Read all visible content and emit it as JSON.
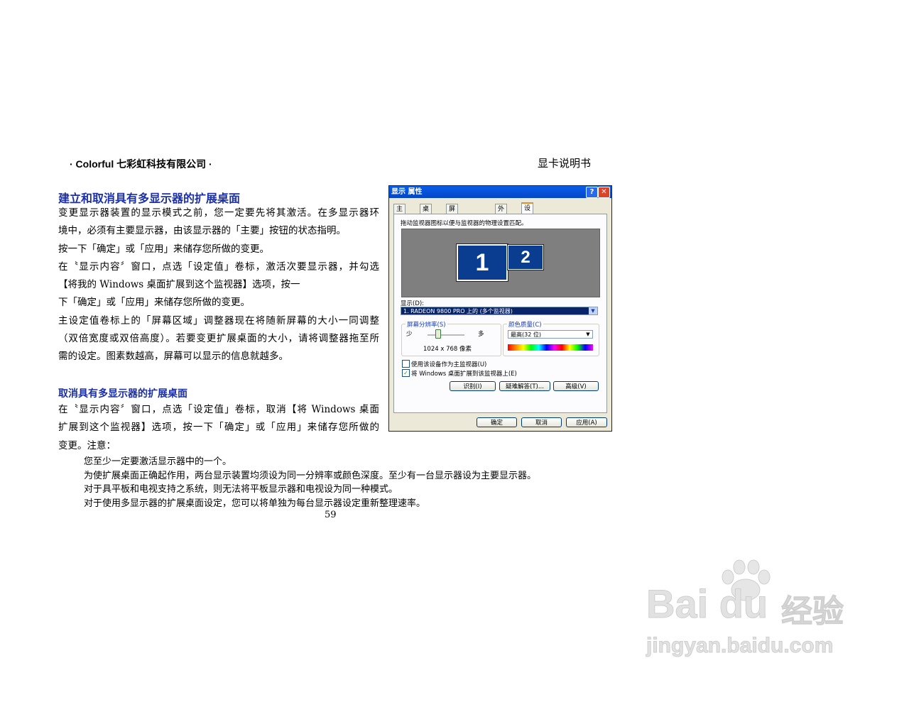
{
  "header": {
    "left": "· Colorful  七彩虹科技有限公司 ·",
    "right": "显卡说明书"
  },
  "section1": {
    "title": "建立和取消具有多显示器的扩展桌面",
    "lines": [
      "变更显示器装置的显示模式之前，您一定要先将其激活。在多显示器环",
      "境中，必须有主要显示器，由该显示器的「主要」按钮的状态指明。",
      "按一下「确定」或「应用」来储存您所做的变更。",
      "在〝显示内容〞窗口，点选「设定值」卷标，激活次要显示器，并勾选",
      "【将我的 Windows 桌面扩展到这个监视器】选项，按一",
      "下「确定」或「应用」来储存您所做的变更。",
      "主设定值卷标上的「屏幕区域」调整器现在将随新屏幕的大小一同调整",
      "（双倍宽度或双倍高度）。若要变更扩展桌面的大小，请将调整器拖至所",
      "需的设定。图素数越高，屏幕可以显示的信息就越多。"
    ]
  },
  "section2": {
    "title": "取消具有多显示器的扩展桌面",
    "lines": [
      "在〝显示内容〞窗口，点选「设定值」卷标，取消【将 Windows 桌面",
      "扩展到这个监视器】选项，按一下「确定」或「应用」来储存您所做的",
      "变更。注意："
    ]
  },
  "notes": [
    "您至少一定要激活显示器中的一个。",
    "为使扩展桌面正确起作用，两台显示装置均须设为同一分辨率或颜色深度。至少有一台显示器设为主要显示器。",
    "对于具平板和电视支持之系统，则无法将平板显示器和电视设为同一种模式。",
    "对于使用多显示器的扩展桌面设定，您可以将单独为每台显示器设定重新整理速率。"
  ],
  "page_number": "59",
  "dialog": {
    "title": "显示 属性",
    "help_glyph": "?",
    "close_glyph": "✕",
    "tabs": [
      "主题",
      "桌面",
      "屏幕保护程序",
      "外观",
      "设置"
    ],
    "active_tab": "设置",
    "instruction": "拖动监视器图标以便与监视器的物理设置匹配。",
    "monitor1": "1",
    "monitor2": "2",
    "display_label": "显示(D):",
    "display_value": "1. RADEON 9800 PRO 上的 (多个监视器)",
    "resolution": {
      "title": "屏幕分辨率(S)",
      "less": "少",
      "more": "多",
      "value": "1024 x 768 像素"
    },
    "color_quality": {
      "title": "颜色质量(C)",
      "value": "最高(32 位)"
    },
    "checkbox_primary": {
      "label": "使用该设备作为主监视器(U)",
      "checked": false
    },
    "checkbox_extend": {
      "label": "将 Windows 桌面扩展到该监视器上(E)",
      "checked": true
    },
    "buttons": {
      "identify": "识别(I)",
      "troubleshoot": "疑难解答(T)...",
      "advanced": "高级(V)",
      "ok": "确定",
      "cancel": "取消",
      "apply": "应用(A)"
    }
  },
  "watermark": {
    "brand": "Bai du",
    "brand_cn": "经验",
    "url": "jingyan.baidu.com"
  }
}
